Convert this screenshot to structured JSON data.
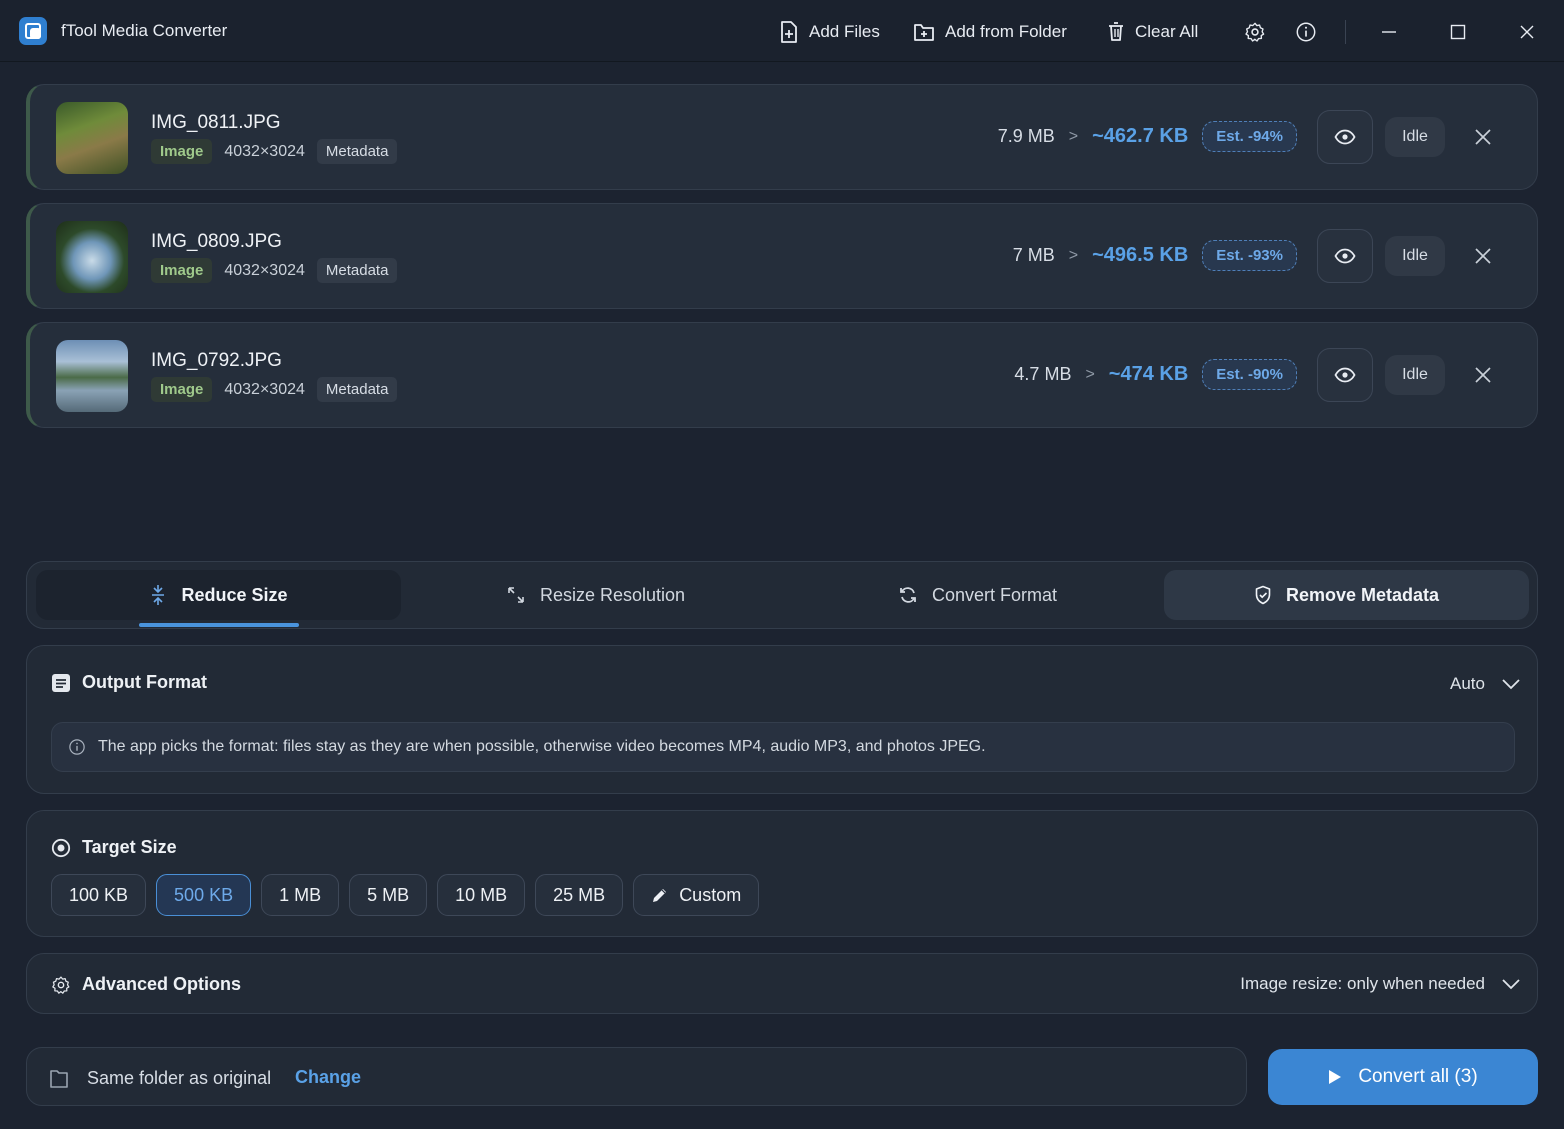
{
  "app": {
    "title": "fTool Media Converter"
  },
  "toolbar": {
    "add_files": "Add Files",
    "add_from_folder": "Add from Folder",
    "clear_all": "Clear All"
  },
  "files": [
    {
      "name": "IMG_0811.JPG",
      "type": "Image",
      "dimensions": "4032×3024",
      "metadata": "Metadata",
      "original_size": "7.9 MB",
      "estimated_size": "~462.7 KB",
      "estimate": "Est. -94%",
      "status": "Idle"
    },
    {
      "name": "IMG_0809.JPG",
      "type": "Image",
      "dimensions": "4032×3024",
      "metadata": "Metadata",
      "original_size": "7 MB",
      "estimated_size": "~496.5 KB",
      "estimate": "Est. -93%",
      "status": "Idle"
    },
    {
      "name": "IMG_0792.JPG",
      "type": "Image",
      "dimensions": "4032×3024",
      "metadata": "Metadata",
      "original_size": "4.7 MB",
      "estimated_size": "~474 KB",
      "estimate": "Est. -90%",
      "status": "Idle"
    }
  ],
  "modes": {
    "tabs": [
      {
        "label": "Reduce Size"
      },
      {
        "label": "Resize Resolution"
      },
      {
        "label": "Convert Format"
      },
      {
        "label": "Remove Metadata"
      }
    ]
  },
  "output_format": {
    "title": "Output Format",
    "selected": "Auto",
    "info": "The app picks the format: files stay as they are when possible, otherwise video becomes MP4, audio MP3, and photos JPEG."
  },
  "target_size": {
    "title": "Target Size",
    "options": [
      "100 KB",
      "500 KB",
      "1 MB",
      "5 MB",
      "10 MB",
      "25 MB"
    ],
    "selected": "500 KB",
    "custom": "Custom"
  },
  "advanced": {
    "title": "Advanced Options",
    "summary": "Image resize: only when needed"
  },
  "output": {
    "folder": "Same folder as original",
    "change": "Change",
    "convert": "Convert all (3)"
  },
  "colors": {
    "accent": "#3b86d3",
    "link": "#5aa1e6",
    "image_badge": "#9fc98b"
  }
}
